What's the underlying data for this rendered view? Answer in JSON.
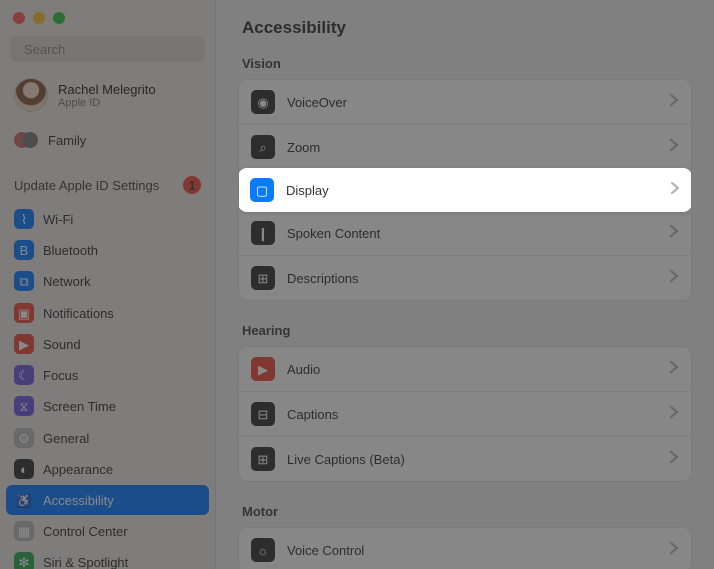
{
  "search": {
    "placeholder": "Search"
  },
  "user": {
    "name": "Rachel Melegrito",
    "sub": "Apple ID"
  },
  "family": {
    "label": "Family"
  },
  "update": {
    "label": "Update Apple ID Settings",
    "badge": "1"
  },
  "sidebar": [
    {
      "label": "Wi-Fi",
      "bg": "#0a7aff",
      "glyph": "⌇"
    },
    {
      "label": "Bluetooth",
      "bg": "#0a7aff",
      "glyph": "B"
    },
    {
      "label": "Network",
      "bg": "#0a7aff",
      "glyph": "⧉"
    },
    {
      "label": "Notifications",
      "bg": "#ec4c3c",
      "glyph": "▣"
    },
    {
      "label": "Sound",
      "bg": "#ec4c3c",
      "glyph": "▶"
    },
    {
      "label": "Focus",
      "bg": "#6e5cdb",
      "glyph": "☾"
    },
    {
      "label": "Screen Time",
      "bg": "#6e5cdb",
      "glyph": "⧖"
    },
    {
      "label": "General",
      "bg": "#b9b9b9",
      "glyph": "⚙"
    },
    {
      "label": "Appearance",
      "bg": "#333333",
      "glyph": "◐"
    },
    {
      "label": "Accessibility",
      "bg": "#0a7aff",
      "glyph": "♿",
      "selected": true
    },
    {
      "label": "Control Center",
      "bg": "#b9b9b9",
      "glyph": "▦"
    },
    {
      "label": "Siri & Spotlight",
      "bg": "#2fa84f",
      "glyph": "✻"
    }
  ],
  "page": {
    "title": "Accessibility"
  },
  "sections": [
    {
      "title": "Vision",
      "rows": [
        {
          "label": "VoiceOver",
          "bg": "#333333",
          "glyph": "◉"
        },
        {
          "label": "Zoom",
          "bg": "#333333",
          "glyph": "⌕"
        },
        {
          "label": "Display",
          "bg": "#0a7aff",
          "glyph": "▢",
          "highlight": true
        },
        {
          "label": "Spoken Content",
          "bg": "#333333",
          "glyph": "❙"
        },
        {
          "label": "Descriptions",
          "bg": "#333333",
          "glyph": "⊞"
        }
      ]
    },
    {
      "title": "Hearing",
      "rows": [
        {
          "label": "Audio",
          "bg": "#ec4c3c",
          "glyph": "▶"
        },
        {
          "label": "Captions",
          "bg": "#333333",
          "glyph": "⊟"
        },
        {
          "label": "Live Captions (Beta)",
          "bg": "#333333",
          "glyph": "⊞"
        }
      ]
    },
    {
      "title": "Motor",
      "rows": [
        {
          "label": "Voice Control",
          "bg": "#333333",
          "glyph": "☼"
        }
      ]
    }
  ]
}
